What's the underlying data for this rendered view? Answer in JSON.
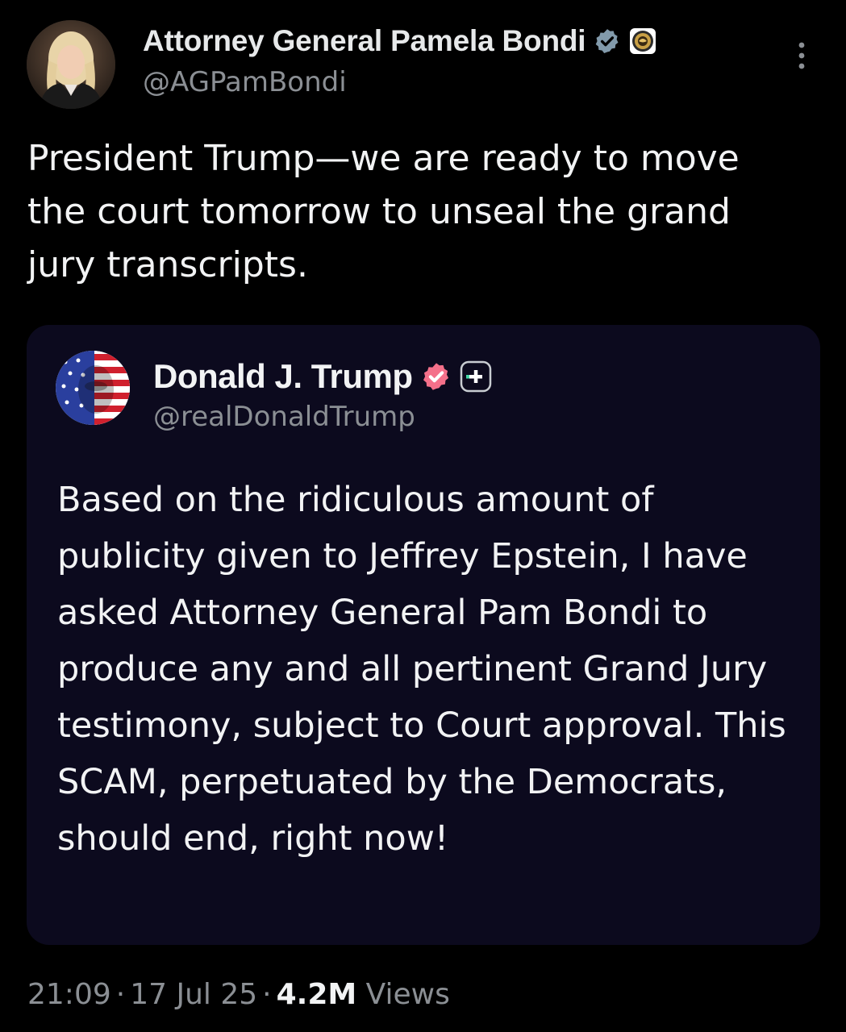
{
  "author": {
    "display_name": "Attorney General Pamela Bondi",
    "handle": "@AGPamBondi",
    "verified_icon": "gray-verified-badge-icon",
    "affiliate_icon": "doj-seal-icon"
  },
  "tweet": {
    "text": "President Trump—we are ready to move the court tomorrow to unseal the grand jury transcripts."
  },
  "quote": {
    "display_name": "Donald J. Trump",
    "handle": "@realDonaldTrump",
    "verified_icon": "pink-verified-badge-icon",
    "platform_icon": "truth-social-plus-icon",
    "text": "Based on the ridiculous amount of publicity given to Jeffrey Epstein, I have asked Attorney General Pam Bondi to produce any and all pertinent Grand Jury testimony, subject to Court approval. This SCAM, perpetuated by the Democrats, should end, right now!"
  },
  "meta": {
    "time": "21:09",
    "separator": "·",
    "date": "17 Jul 25",
    "views_count": "4.2M",
    "views_label": "Views"
  },
  "colors": {
    "background": "#000000",
    "quote_background": "#0c0a1e",
    "primary_text": "#e7e9ea",
    "secondary_text": "#8b8f94",
    "gray_badge": "#829aab",
    "pink_badge": "#f4708a"
  }
}
